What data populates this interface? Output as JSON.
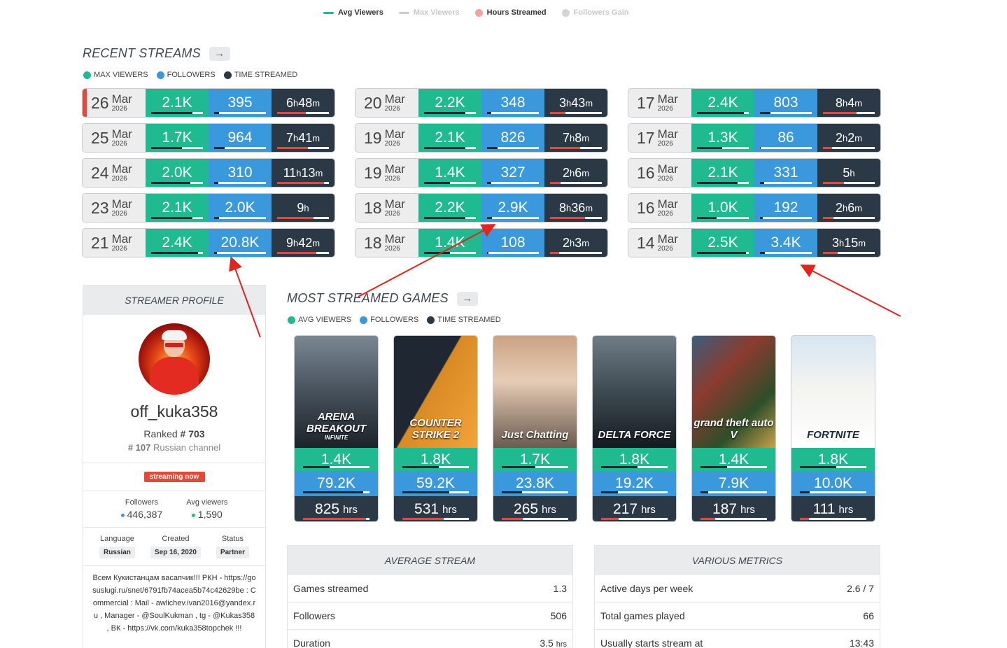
{
  "top_legend": [
    {
      "label": "Avg Viewers",
      "color": "#1fba8f",
      "shape": "line",
      "active": true
    },
    {
      "label": "Max Viewers",
      "color": "#cccccc",
      "shape": "line",
      "active": false
    },
    {
      "label": "Hours Streamed",
      "color": "#f4a3a0",
      "shape": "dot",
      "active": true
    },
    {
      "label": "Followers Gain",
      "color": "#d3d3d3",
      "shape": "dot",
      "active": false
    }
  ],
  "recent": {
    "title": "RECENT STREAMS",
    "legend": [
      "MAX VIEWERS",
      "FOLLOWERS",
      "TIME STREAMED"
    ],
    "columns": [
      [
        {
          "day": "26",
          "month": "Mar",
          "year": "2026",
          "max": "2.1K",
          "fol": "395",
          "h": "6",
          "m": "48",
          "pmax": 0.8,
          "pfol": 0.1,
          "ptime": 0.55,
          "live": true
        },
        {
          "day": "25",
          "month": "Mar",
          "year": "2026",
          "max": "1.7K",
          "fol": "964",
          "h": "7",
          "m": "41",
          "pmax": 0.6,
          "pfol": 0.2,
          "ptime": 0.6
        },
        {
          "day": "24",
          "month": "Mar",
          "year": "2026",
          "max": "2.0K",
          "fol": "310",
          "h": "11",
          "m": "13",
          "pmax": 0.75,
          "pfol": 0.08,
          "ptime": 0.9
        },
        {
          "day": "23",
          "month": "Mar",
          "year": "2026",
          "max": "2.1K",
          "fol": "2.0K",
          "h": "9",
          "m": "",
          "pmax": 0.8,
          "pfol": 0.1,
          "ptime": 0.7
        },
        {
          "day": "21",
          "month": "Mar",
          "year": "2026",
          "max": "2.4K",
          "fol": "20.8K",
          "h": "9",
          "m": "42",
          "pmax": 0.9,
          "pfol": 0.05,
          "ptime": 0.75
        }
      ],
      [
        {
          "day": "20",
          "month": "Mar",
          "year": "2026",
          "max": "2.2K",
          "fol": "348",
          "h": "3",
          "m": "43",
          "pmax": 0.8,
          "pfol": 0.08,
          "ptime": 0.3
        },
        {
          "day": "19",
          "month": "Mar",
          "year": "2026",
          "max": "2.1K",
          "fol": "826",
          "h": "7",
          "m": "8",
          "pmax": 0.8,
          "pfol": 0.2,
          "ptime": 0.58
        },
        {
          "day": "19",
          "month": "Mar",
          "year": "2026",
          "max": "1.4K",
          "fol": "327",
          "h": "2",
          "m": "6",
          "pmax": 0.5,
          "pfol": 0.08,
          "ptime": 0.2
        },
        {
          "day": "18",
          "month": "Mar",
          "year": "2026",
          "max": "2.2K",
          "fol": "2.9K",
          "h": "8",
          "m": "36",
          "pmax": 0.8,
          "pfol": 0.1,
          "ptime": 0.68
        },
        {
          "day": "18",
          "month": "Mar",
          "year": "2026",
          "max": "1.4K",
          "fol": "108",
          "h": "2",
          "m": "3",
          "pmax": 0.5,
          "pfol": 0.03,
          "ptime": 0.18
        }
      ],
      [
        {
          "day": "17",
          "month": "Mar",
          "year": "2026",
          "max": "2.4K",
          "fol": "803",
          "h": "8",
          "m": "4",
          "pmax": 0.9,
          "pfol": 0.2,
          "ptime": 0.65
        },
        {
          "day": "17",
          "month": "Mar",
          "year": "2026",
          "max": "1.3K",
          "fol": "86",
          "h": "2",
          "m": "2",
          "pmax": 0.48,
          "pfol": 0.02,
          "ptime": 0.18
        },
        {
          "day": "16",
          "month": "Mar",
          "year": "2026",
          "max": "2.1K",
          "fol": "331",
          "h": "5",
          "m": "",
          "pmax": 0.78,
          "pfol": 0.08,
          "ptime": 0.4
        },
        {
          "day": "16",
          "month": "Mar",
          "year": "2026",
          "max": "1.0K",
          "fol": "192",
          "h": "2",
          "m": "6",
          "pmax": 0.38,
          "pfol": 0.05,
          "ptime": 0.2
        },
        {
          "day": "14",
          "month": "Mar",
          "year": "2026",
          "max": "2.5K",
          "fol": "3.4K",
          "h": "3",
          "m": "15",
          "pmax": 0.95,
          "pfol": 0.1,
          "ptime": 0.28
        }
      ]
    ]
  },
  "profile": {
    "header": "STREAMER PROFILE",
    "name": "off_kuka358",
    "ranked_label": "Ranked",
    "rank": "# 703",
    "channel_rank": "# 107",
    "channel_label": "Russian channel",
    "live_badge": "streaming now",
    "followers_label": "Followers",
    "followers": "446,387",
    "avg_label": "Avg viewers",
    "avg": "1,590",
    "language_label": "Language",
    "language": "Russian",
    "created_label": "Created",
    "created": "Sep 16, 2020",
    "status_label": "Status",
    "status": "Partner",
    "description": "Всем Кукистанцам васапчик!!! РКН - https://gosuslugi.ru/snet/6791fb74acea5b74c42629be : Commercial : Mail - awlichev.ivan2016@yandex.ru , Manager - @SoulKukman , tg - @Kukas358 , ВК - https://vk.com/kuka358topchek !!!"
  },
  "games": {
    "title": "MOST STREAMED GAMES",
    "legend": [
      "AVG VIEWERS",
      "FOLLOWERS",
      "TIME STREAMED"
    ],
    "hrs_unit": "hrs",
    "items": [
      {
        "title": "ARENA BREAKOUT",
        "subtitle": "INFINITE",
        "avg": "1.4K",
        "fol": "79.2K",
        "hrs": "825",
        "bg": "linear-gradient(180deg,#7a8792 0%,#4b5661 45%,#1c2229 100%)",
        "pavg": 0.4,
        "pfol": 0.9,
        "phrs": 0.95
      },
      {
        "title": "COUNTER STRIKE 2",
        "subtitle": "",
        "avg": "1.8K",
        "fol": "59.2K",
        "hrs": "531",
        "bg": "linear-gradient(120deg,#1f2733 0%,#1f2733 45%,#d98a24 46%,#f2a43a 100%)",
        "pavg": 0.55,
        "pfol": 0.7,
        "phrs": 0.62
      },
      {
        "title": "Just Chatting",
        "subtitle": "",
        "avg": "1.7K",
        "fol": "23.8K",
        "hrs": "265",
        "bg": "linear-gradient(180deg,#caa384 0%,#e7cdb5 40%,#6b5a4f 100%)",
        "pavg": 0.5,
        "pfol": 0.3,
        "phrs": 0.32
      },
      {
        "title": "DELTA FORCE",
        "subtitle": "",
        "avg": "1.8K",
        "fol": "19.2K",
        "hrs": "217",
        "bg": "linear-gradient(180deg,#6f7c85 0%,#3e4a52 50%,#141b20 100%)",
        "pavg": 0.55,
        "pfol": 0.25,
        "phrs": 0.26
      },
      {
        "title": "grand theft auto V",
        "subtitle": "",
        "avg": "1.4K",
        "fol": "7.9K",
        "hrs": "187",
        "bg": "linear-gradient(135deg,#3a5e7c 0%,#8b3b2f 35%,#2d4f2a 70%,#c9a24a 100%)",
        "pavg": 0.4,
        "pfol": 0.12,
        "phrs": 0.22
      },
      {
        "title": "FORTNITE",
        "subtitle": "",
        "avg": "1.8K",
        "fol": "10.0K",
        "hrs": "111",
        "bg": "linear-gradient(180deg,#d7e6f2 0%,#f3f3f0 45%,#ffffff 100%)",
        "pavg": 0.55,
        "pfol": 0.15,
        "phrs": 0.14,
        "dark_title": true
      }
    ]
  },
  "average_stream": {
    "title": "AVERAGE STREAM",
    "rows": [
      {
        "label": "Games streamed",
        "value": "1.3",
        "unit": ""
      },
      {
        "label": "Followers",
        "value": "506",
        "unit": ""
      },
      {
        "label": "Duration",
        "value": "3.5",
        "unit": "hrs"
      }
    ]
  },
  "various_metrics": {
    "title": "VARIOUS METRICS",
    "rows": [
      {
        "label": "Active days per week",
        "value": "2.6 / 7"
      },
      {
        "label": "Total games played",
        "value": "66"
      },
      {
        "label": "Usually starts stream at",
        "value": "13:43"
      }
    ]
  },
  "colors": {
    "green": "#1fba8f",
    "blue": "#3a98dd",
    "dark": "#2b3947",
    "red": "#e5473a"
  }
}
